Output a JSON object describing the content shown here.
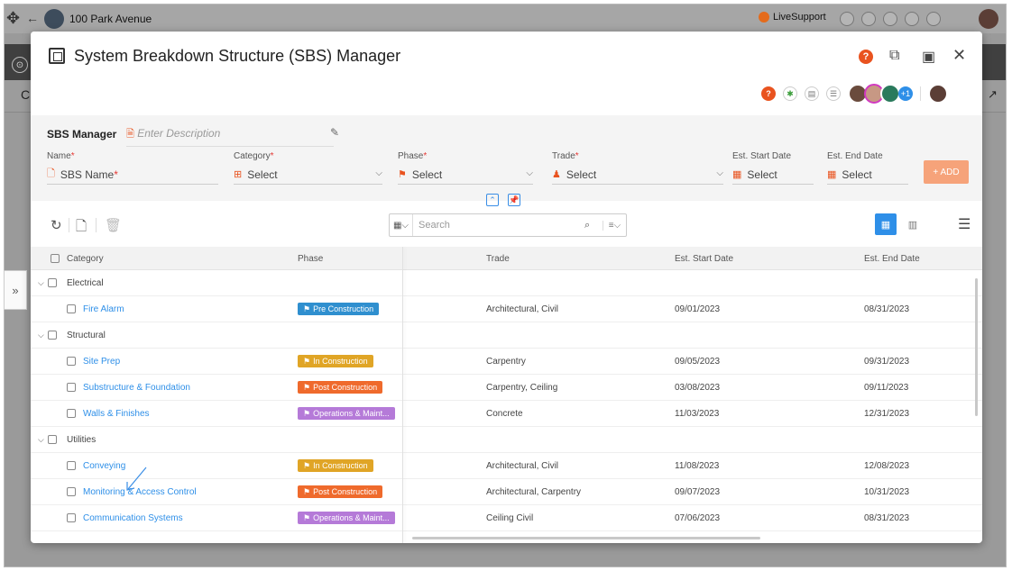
{
  "background": {
    "project_name": "100 Park Avenue",
    "live_support": "LiveSupport",
    "sub_letter": "C"
  },
  "modal": {
    "title": "System Breakdown Structure (SBS) Manager",
    "help": "?",
    "avatars_more": "+1"
  },
  "form": {
    "section_label": "SBS Manager",
    "description_placeholder": "Enter Description",
    "fields": {
      "name_label": "Name",
      "name_value": "SBS Name",
      "category_label": "Category",
      "category_value": "Select",
      "phase_label": "Phase",
      "phase_value": "Select",
      "trade_label": "Trade",
      "trade_value": "Select",
      "start_label": "Est. Start Date",
      "start_value": "Select",
      "end_label": "Est. End Date",
      "end_value": "Select"
    },
    "required_mark": "*",
    "add_button": "+ ADD"
  },
  "toolbar": {
    "search_placeholder": "Search"
  },
  "grid": {
    "columns": [
      "Category",
      "Phase",
      "Trade",
      "Est. Start Date",
      "Est. End Date"
    ],
    "groups": [
      {
        "name": "Electrical",
        "rows": [
          {
            "category": "Fire Alarm",
            "phase": "Pre Construction",
            "trade": "Architectural, Civil",
            "start": "09/01/2023",
            "end": "08/31/2023"
          }
        ]
      },
      {
        "name": "Structural",
        "rows": [
          {
            "category": "Site Prep",
            "phase": "In Construction",
            "trade": "Carpentry",
            "start": "09/05/2023",
            "end": "09/31/2023"
          },
          {
            "category": "Substructure & Foundation",
            "phase": "Post Construction",
            "trade": "Carpentry, Ceiling",
            "start": "03/08/2023",
            "end": "09/11/2023"
          },
          {
            "category": "Walls & Finishes",
            "phase": "Operations & Maint...",
            "trade": "Concrete",
            "start": "11/03/2023",
            "end": "12/31/2023"
          }
        ]
      },
      {
        "name": "Utilities",
        "rows": [
          {
            "category": "Conveying",
            "phase": "In Construction",
            "trade": "Architectural, Civil",
            "start": "11/08/2023",
            "end": "12/08/2023"
          },
          {
            "category": "Monitoring & Access Control",
            "phase": "Post Construction",
            "trade": "Architectural, Carpentry",
            "start": "09/07/2023",
            "end": "10/31/2023"
          },
          {
            "category": "Communication Systems",
            "phase": "Operations & Maint...",
            "trade": "Ceiling Civil",
            "start": "07/06/2023",
            "end": "08/31/2023"
          }
        ]
      }
    ]
  },
  "colors": {
    "accent": "#2e8fe8",
    "pre_construction": "#2f8fcf",
    "in_construction": "#e0a526",
    "post_construction": "#ef6a2c",
    "operations": "#b57ad8",
    "add_button": "#f6a37a"
  }
}
